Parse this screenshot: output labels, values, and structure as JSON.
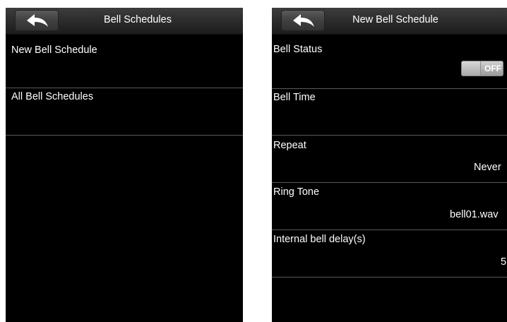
{
  "left_screen": {
    "title": "Bell Schedules",
    "items": [
      {
        "label": "New Bell Schedule"
      },
      {
        "label": "All Bell Schedules"
      }
    ]
  },
  "right_screen": {
    "title": "New Bell Schedule",
    "fields": {
      "bell_status": {
        "label": "Bell Status",
        "toggle_text": "OFF"
      },
      "bell_time": {
        "label": "Bell Time"
      },
      "repeat": {
        "label": "Repeat",
        "value": "Never"
      },
      "ring_tone": {
        "label": "Ring Tone",
        "value": "bell01.wav"
      },
      "internal_bell_delay": {
        "label": "Internal bell delay(s)",
        "value": "5"
      }
    }
  },
  "icons": {
    "back": "back-arrow-icon"
  },
  "colors": {
    "background": "#000000",
    "text": "#ffffff",
    "divider": "#5a5a5a",
    "toggle": "#c8c8c8"
  }
}
